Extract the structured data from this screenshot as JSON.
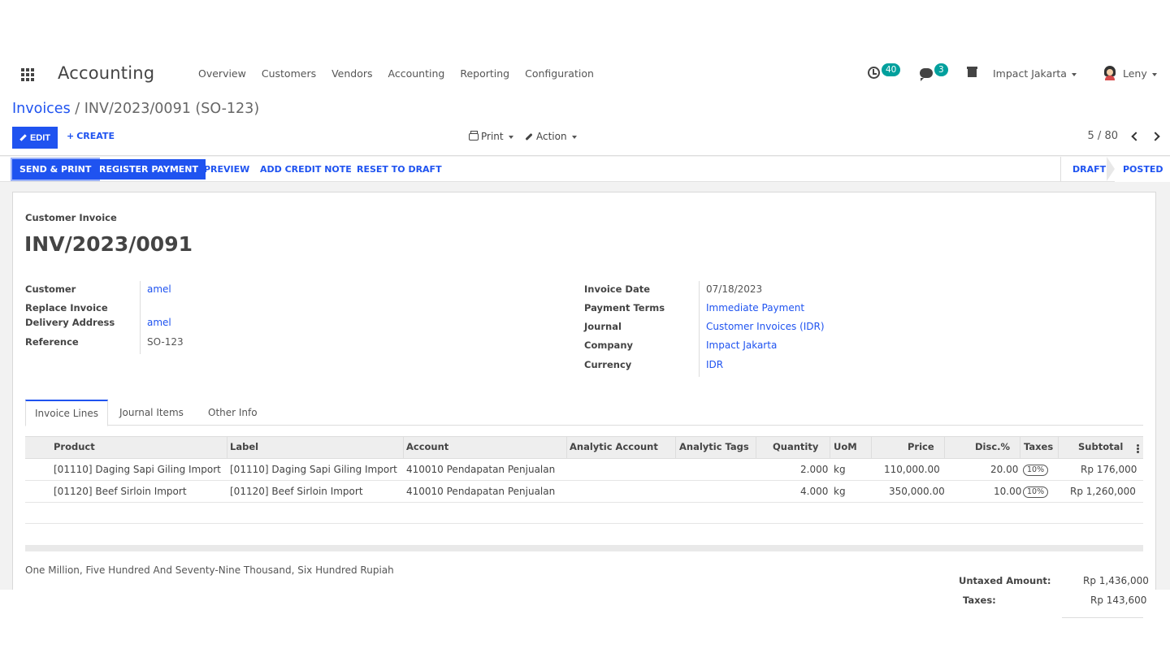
{
  "app": {
    "title": "Accounting",
    "menu": [
      "Overview",
      "Customers",
      "Vendors",
      "Accounting",
      "Reporting",
      "Configuration"
    ],
    "activity_count": "40",
    "message_count": "3",
    "company": "Impact Jakarta",
    "user": "Leny"
  },
  "breadcrumb": {
    "parent": "Invoices",
    "separator": "/",
    "current": "INV/2023/0091 (SO-123)"
  },
  "controls": {
    "edit": "EDIT",
    "create": "CREATE",
    "print": "Print",
    "action": "Action",
    "pager": "5 / 80"
  },
  "statusbar": {
    "buttons": [
      "SEND & PRINT",
      "REGISTER PAYMENT",
      "PREVIEW",
      "ADD CREDIT NOTE",
      "RESET TO DRAFT"
    ],
    "stages": [
      "DRAFT",
      "POSTED"
    ],
    "active_stage": "POSTED"
  },
  "invoice": {
    "type": "Customer Invoice",
    "name": "INV/2023/0091",
    "left_fields": [
      {
        "label": "Customer",
        "value": "amel"
      },
      {
        "label": "Replace Invoice",
        "value": ""
      },
      {
        "label": "Delivery Address",
        "value": "amel"
      },
      {
        "label": "Reference",
        "value": "SO-123"
      }
    ],
    "right_fields": [
      {
        "label": "Invoice Date",
        "value": "07/18/2023"
      },
      {
        "label": "Payment Terms",
        "value": "Immediate Payment"
      },
      {
        "label": "Journal",
        "value": "Customer Invoices (IDR)"
      },
      {
        "label": "Company",
        "value": "Impact Jakarta"
      },
      {
        "label": "Currency",
        "value": "IDR"
      }
    ]
  },
  "tabs": [
    "Invoice Lines",
    "Journal Items",
    "Other Info"
  ],
  "lines": {
    "headers": [
      "Product",
      "Label",
      "Account",
      "Analytic Account",
      "Analytic Tags",
      "Quantity",
      "UoM",
      "Price",
      "Disc.%",
      "Taxes",
      "Subtotal"
    ],
    "rows": [
      {
        "product": "[01110] Daging Sapi Giling Import",
        "label": "[01110] Daging Sapi Giling Import",
        "account": "410010 Pendapatan Penjualan",
        "analytic_account": "",
        "analytic_tags": "",
        "quantity": "2.000",
        "uom": "kg",
        "price": "110,000.00",
        "discount": "20.00",
        "tax": "10%",
        "subtotal": "Rp 176,000"
      },
      {
        "product": "[01120] Beef Sirloin Import",
        "label": "[01120] Beef Sirloin Import",
        "account": "410010 Pendapatan Penjualan",
        "analytic_account": "",
        "analytic_tags": "",
        "quantity": "4.000",
        "uom": "kg",
        "price": "350,000.00",
        "discount": "10.00",
        "tax": "10%",
        "subtotal": "Rp 1,260,000"
      }
    ]
  },
  "amount_in_words": "One Million, Five Hundred And Seventy-Nine Thousand, Six Hundred Rupiah",
  "totals": [
    {
      "label": "Untaxed Amount:",
      "value": "Rp 1,436,000"
    },
    {
      "label": "Taxes:",
      "value": "Rp 143,600"
    }
  ],
  "colors": {
    "accent": "#1f53f0",
    "badge": "#00a09d"
  }
}
